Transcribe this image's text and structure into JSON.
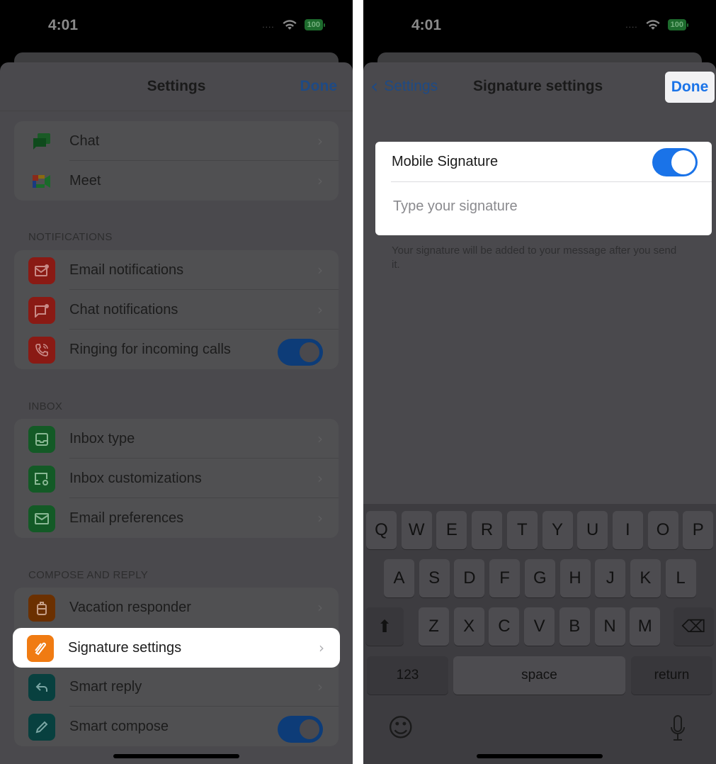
{
  "left": {
    "status": {
      "time": "4:01",
      "signal": "....",
      "battery": "100"
    },
    "nav": {
      "title": "Settings",
      "done": "Done"
    },
    "apps_group": [
      {
        "label": "Chat",
        "icon": "chat-icon"
      },
      {
        "label": "Meet",
        "icon": "meet-icon"
      }
    ],
    "notifications": {
      "header": "NOTIFICATIONS",
      "items": [
        {
          "label": "Email notifications",
          "icon": "email-notification-icon",
          "color": "#8a1a14"
        },
        {
          "label": "Chat notifications",
          "icon": "chat-notification-icon",
          "color": "#8a1a14"
        },
        {
          "label": "Ringing for incoming calls",
          "icon": "phone-ringing-icon",
          "color": "#8a1a14",
          "toggle": true
        }
      ]
    },
    "inbox": {
      "header": "INBOX",
      "items": [
        {
          "label": "Inbox type",
          "icon": "inbox-icon",
          "color": "#135a26"
        },
        {
          "label": "Inbox customizations",
          "icon": "inbox-settings-icon",
          "color": "#135a26"
        },
        {
          "label": "Email preferences",
          "icon": "envelope-icon",
          "color": "#135a26"
        }
      ]
    },
    "compose": {
      "header": "COMPOSE AND REPLY",
      "items": [
        {
          "label": "Vacation responder",
          "icon": "suitcase-icon",
          "color": "#6b3000"
        },
        {
          "label": "Signature settings",
          "icon": "signature-pen-icon",
          "color": "#f07b12",
          "highlighted": true
        },
        {
          "label": "Smart reply",
          "icon": "reply-icon",
          "color": "#08403f"
        },
        {
          "label": "Smart compose",
          "icon": "pencil-icon",
          "color": "#08403f",
          "toggle": true
        }
      ]
    },
    "chevron": "›"
  },
  "right": {
    "status": {
      "time": "4:01",
      "signal": "....",
      "battery": "100"
    },
    "nav": {
      "back": "Settings",
      "title": "Signature settings",
      "done": "Done"
    },
    "signature": {
      "label": "Mobile Signature",
      "enabled": true,
      "placeholder": "Type your signature",
      "value": "",
      "help": "Your signature will be added to your message after you send it."
    },
    "keyboard": {
      "row1": [
        "Q",
        "W",
        "E",
        "R",
        "T",
        "Y",
        "U",
        "I",
        "O",
        "P"
      ],
      "row2": [
        "A",
        "S",
        "D",
        "F",
        "G",
        "H",
        "J",
        "K",
        "L"
      ],
      "row3": [
        "Z",
        "X",
        "C",
        "V",
        "B",
        "N",
        "M"
      ],
      "numbers": "123",
      "space": "space",
      "return": "return",
      "shift_glyph": "⬆",
      "delete_glyph": "⌫",
      "emoji_glyph": "☺",
      "mic_glyph": "🎙"
    }
  }
}
